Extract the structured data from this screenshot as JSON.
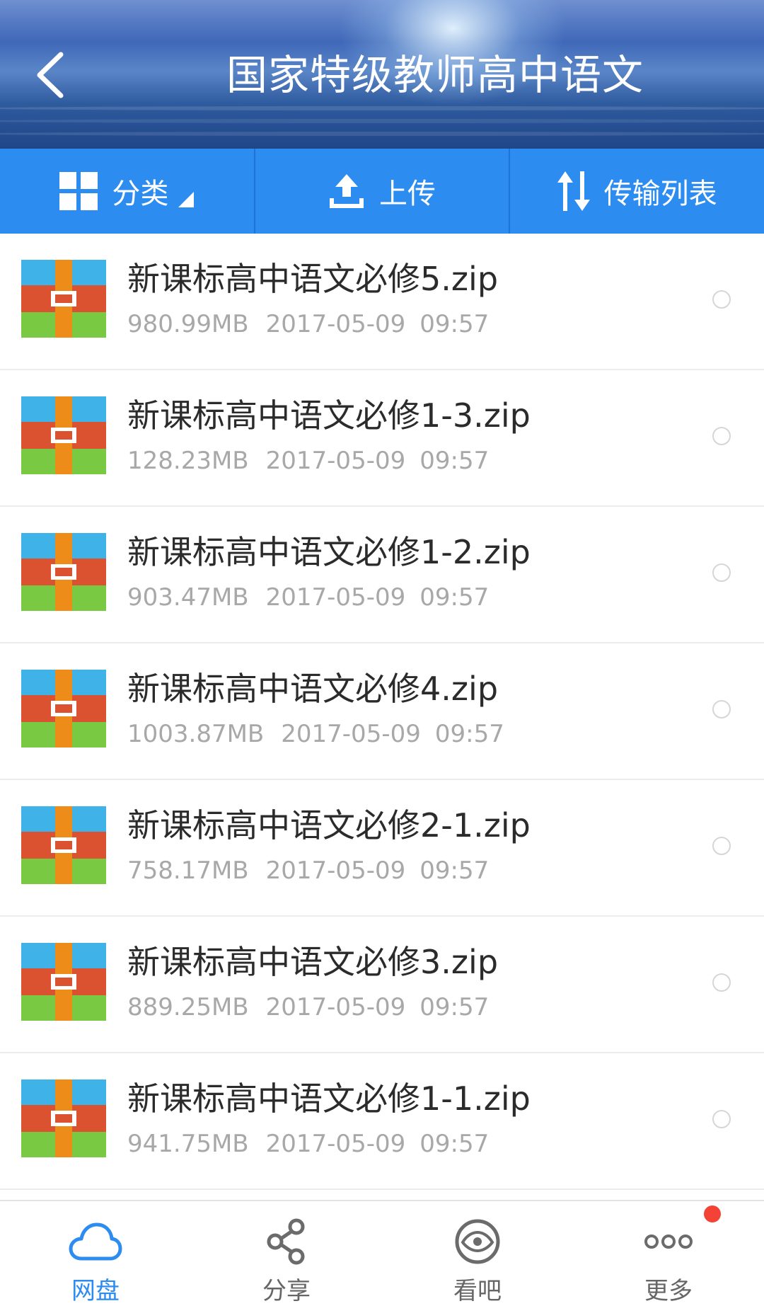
{
  "header": {
    "title": "国家特级教师高中语文",
    "back_icon": "chevron-left-icon"
  },
  "toolbar": {
    "category_label": "分类",
    "upload_label": "上传",
    "transfer_label": "传输列表"
  },
  "files": [
    {
      "name": "新课标高中语文必修5.zip",
      "size": "980.99MB",
      "date": "2017-05-09",
      "time": "09:57"
    },
    {
      "name": "新课标高中语文必修1-3.zip",
      "size": "128.23MB",
      "date": "2017-05-09",
      "time": "09:57"
    },
    {
      "name": "新课标高中语文必修1-2.zip",
      "size": "903.47MB",
      "date": "2017-05-09",
      "time": "09:57"
    },
    {
      "name": "新课标高中语文必修4.zip",
      "size": "1003.87MB",
      "date": "2017-05-09",
      "time": "09:57"
    },
    {
      "name": "新课标高中语文必修2-1.zip",
      "size": "758.17MB",
      "date": "2017-05-09",
      "time": "09:57"
    },
    {
      "name": "新课标高中语文必修3.zip",
      "size": "889.25MB",
      "date": "2017-05-09",
      "time": "09:57"
    },
    {
      "name": "新课标高中语文必修1-1.zip",
      "size": "941.75MB",
      "date": "2017-05-09",
      "time": "09:57"
    }
  ],
  "bottom_nav": {
    "items": [
      {
        "label": "网盘",
        "icon": "cloud-icon",
        "active": true
      },
      {
        "label": "分享",
        "icon": "share-icon",
        "active": false
      },
      {
        "label": "看吧",
        "icon": "eye-icon",
        "active": false
      },
      {
        "label": "更多",
        "icon": "more-dots-icon",
        "active": false
      }
    ]
  },
  "colors": {
    "accent": "#2d8cf0",
    "badge": "#f44336",
    "secondary_text": "#a8a8a8"
  }
}
